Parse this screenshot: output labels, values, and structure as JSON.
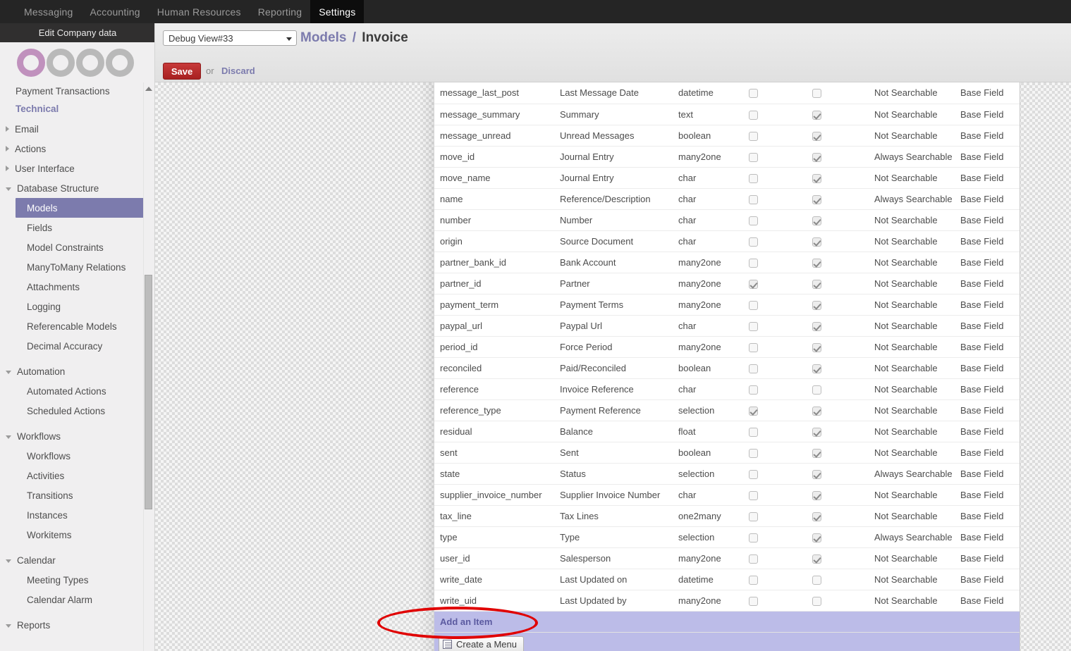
{
  "topnav": {
    "items": [
      {
        "label": "Messaging",
        "active": false
      },
      {
        "label": "Accounting",
        "active": false
      },
      {
        "label": "Human Resources",
        "active": false
      },
      {
        "label": "Reporting",
        "active": false
      },
      {
        "label": "Settings",
        "active": true
      }
    ]
  },
  "sidebar": {
    "edit_company_label": "Edit Company data",
    "progress_rings": {
      "total": 4,
      "completed": 1,
      "active_color": "#c091bd",
      "inactive_color": "#b9b9b9"
    },
    "partial_top_item": "Payment Transactions",
    "section_title": "Technical",
    "groups": [
      {
        "label": "Email",
        "expanded": false
      },
      {
        "label": "Actions",
        "expanded": false
      },
      {
        "label": "User Interface",
        "expanded": false
      },
      {
        "label": "Database Structure",
        "expanded": true
      }
    ],
    "database_structure_items": [
      {
        "label": "Models",
        "selected": true
      },
      {
        "label": "Fields",
        "selected": false
      },
      {
        "label": "Model Constraints",
        "selected": false
      },
      {
        "label": "ManyToMany Relations",
        "selected": false
      },
      {
        "label": "Attachments",
        "selected": false
      },
      {
        "label": "Logging",
        "selected": false
      },
      {
        "label": "Referencable Models",
        "selected": false
      },
      {
        "label": "Decimal Accuracy",
        "selected": false
      }
    ],
    "automation_group": "Automation",
    "automation_items": [
      {
        "label": "Automated Actions"
      },
      {
        "label": "Scheduled Actions"
      }
    ],
    "workflows_group": "Workflows",
    "workflows_items": [
      {
        "label": "Workflows"
      },
      {
        "label": "Activities"
      },
      {
        "label": "Transitions"
      },
      {
        "label": "Instances"
      },
      {
        "label": "Workitems"
      }
    ],
    "calendar_group": "Calendar",
    "calendar_items": [
      {
        "label": "Meeting Types"
      },
      {
        "label": "Calendar Alarm"
      }
    ],
    "reports_group": "Reports"
  },
  "toolbar": {
    "view_select_value": "Debug View#33",
    "breadcrumb_parent": "Models",
    "breadcrumb_separator": "/",
    "breadcrumb_current": "Invoice",
    "save_label": "Save",
    "or_label": "or",
    "discard_label": "Discard"
  },
  "list": {
    "add_item_label": "Add an Item",
    "rows": [
      {
        "name": "message_last_post",
        "label": "Last Message Date",
        "type": "datetime",
        "required": false,
        "readonly": false,
        "searchable": "Not Searchable",
        "kind": "Base Field"
      },
      {
        "name": "message_summary",
        "label": "Summary",
        "type": "text",
        "required": false,
        "readonly": true,
        "searchable": "Not Searchable",
        "kind": "Base Field"
      },
      {
        "name": "message_unread",
        "label": "Unread Messages",
        "type": "boolean",
        "required": false,
        "readonly": true,
        "searchable": "Not Searchable",
        "kind": "Base Field"
      },
      {
        "name": "move_id",
        "label": "Journal Entry",
        "type": "many2one",
        "required": false,
        "readonly": true,
        "searchable": "Always Searchable",
        "kind": "Base Field"
      },
      {
        "name": "move_name",
        "label": "Journal Entry",
        "type": "char",
        "required": false,
        "readonly": true,
        "searchable": "Not Searchable",
        "kind": "Base Field"
      },
      {
        "name": "name",
        "label": "Reference/Description",
        "type": "char",
        "required": false,
        "readonly": true,
        "searchable": "Always Searchable",
        "kind": "Base Field"
      },
      {
        "name": "number",
        "label": "Number",
        "type": "char",
        "required": false,
        "readonly": true,
        "searchable": "Not Searchable",
        "kind": "Base Field"
      },
      {
        "name": "origin",
        "label": "Source Document",
        "type": "char",
        "required": false,
        "readonly": true,
        "searchable": "Not Searchable",
        "kind": "Base Field"
      },
      {
        "name": "partner_bank_id",
        "label": "Bank Account",
        "type": "many2one",
        "required": false,
        "readonly": true,
        "searchable": "Not Searchable",
        "kind": "Base Field"
      },
      {
        "name": "partner_id",
        "label": "Partner",
        "type": "many2one",
        "required": true,
        "readonly": true,
        "searchable": "Not Searchable",
        "kind": "Base Field"
      },
      {
        "name": "payment_term",
        "label": "Payment Terms",
        "type": "many2one",
        "required": false,
        "readonly": true,
        "searchable": "Not Searchable",
        "kind": "Base Field"
      },
      {
        "name": "paypal_url",
        "label": "Paypal Url",
        "type": "char",
        "required": false,
        "readonly": true,
        "searchable": "Not Searchable",
        "kind": "Base Field"
      },
      {
        "name": "period_id",
        "label": "Force Period",
        "type": "many2one",
        "required": false,
        "readonly": true,
        "searchable": "Not Searchable",
        "kind": "Base Field"
      },
      {
        "name": "reconciled",
        "label": "Paid/Reconciled",
        "type": "boolean",
        "required": false,
        "readonly": true,
        "searchable": "Not Searchable",
        "kind": "Base Field"
      },
      {
        "name": "reference",
        "label": "Invoice Reference",
        "type": "char",
        "required": false,
        "readonly": false,
        "searchable": "Not Searchable",
        "kind": "Base Field"
      },
      {
        "name": "reference_type",
        "label": "Payment Reference",
        "type": "selection",
        "required": true,
        "readonly": true,
        "searchable": "Not Searchable",
        "kind": "Base Field"
      },
      {
        "name": "residual",
        "label": "Balance",
        "type": "float",
        "required": false,
        "readonly": true,
        "searchable": "Not Searchable",
        "kind": "Base Field"
      },
      {
        "name": "sent",
        "label": "Sent",
        "type": "boolean",
        "required": false,
        "readonly": true,
        "searchable": "Not Searchable",
        "kind": "Base Field"
      },
      {
        "name": "state",
        "label": "Status",
        "type": "selection",
        "required": false,
        "readonly": true,
        "searchable": "Always Searchable",
        "kind": "Base Field"
      },
      {
        "name": "supplier_invoice_number",
        "label": "Supplier Invoice Number",
        "type": "char",
        "required": false,
        "readonly": true,
        "searchable": "Not Searchable",
        "kind": "Base Field"
      },
      {
        "name": "tax_line",
        "label": "Tax Lines",
        "type": "one2many",
        "required": false,
        "readonly": true,
        "searchable": "Not Searchable",
        "kind": "Base Field"
      },
      {
        "name": "type",
        "label": "Type",
        "type": "selection",
        "required": false,
        "readonly": true,
        "searchable": "Always Searchable",
        "kind": "Base Field"
      },
      {
        "name": "user_id",
        "label": "Salesperson",
        "type": "many2one",
        "required": false,
        "readonly": true,
        "searchable": "Not Searchable",
        "kind": "Base Field"
      },
      {
        "name": "write_date",
        "label": "Last Updated on",
        "type": "datetime",
        "required": false,
        "readonly": false,
        "searchable": "Not Searchable",
        "kind": "Base Field"
      },
      {
        "name": "write_uid",
        "label": "Last Updated by",
        "type": "many2one",
        "required": false,
        "readonly": false,
        "searchable": "Not Searchable",
        "kind": "Base Field"
      }
    ]
  },
  "footer": {
    "create_menu_label": "Create a Menu"
  },
  "annotation": {
    "highlight_color": "#e00000",
    "target": "Add an Item"
  }
}
